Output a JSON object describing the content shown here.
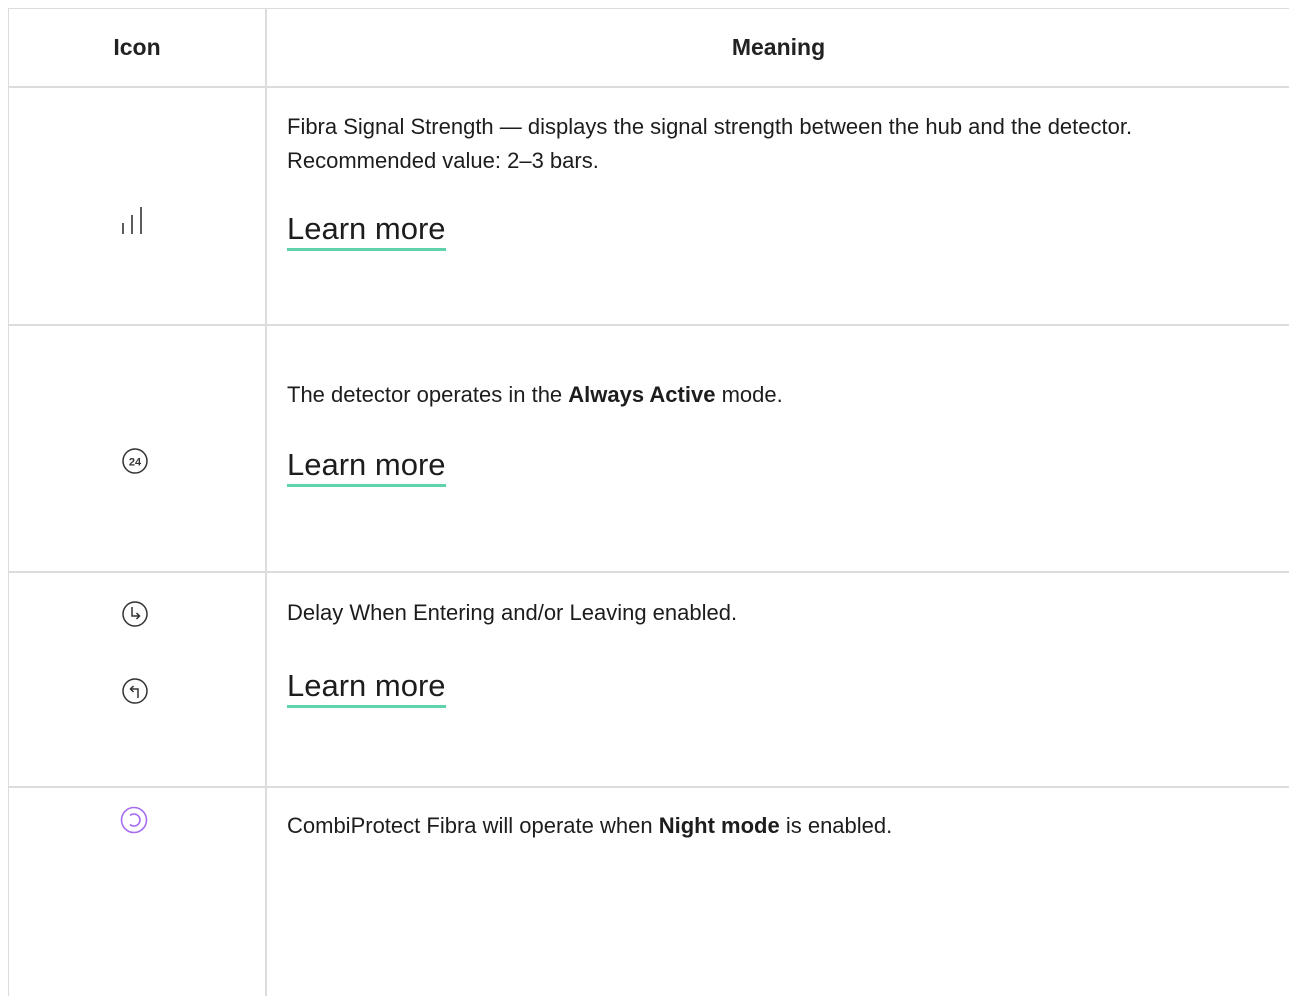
{
  "table": {
    "headers": {
      "icon": "Icon",
      "meaning": "Meaning"
    },
    "rows": [
      {
        "icons": [
          "signal-strength-icon"
        ],
        "description": "Fibra Signal Strength — displays the signal strength between the hub and the detector. Recommended value: 2–3 bars.",
        "link": "Learn more"
      },
      {
        "icons": [
          "always-active-24-icon"
        ],
        "icon_text": "24",
        "description_before": "The detector operates in the ",
        "description_bold": "Always Active",
        "description_after": " mode.",
        "link": "Learn more"
      },
      {
        "icons": [
          "delay-entering-icon",
          "delay-leaving-icon"
        ],
        "description": "Delay When Entering and/or Leaving enabled.",
        "link": "Learn more"
      },
      {
        "icons": [
          "night-mode-icon"
        ],
        "description_before": "CombiProtect Fibra will operate when ",
        "description_bold": "Night mode",
        "description_after": " is enabled."
      }
    ]
  },
  "colors": {
    "border": "#dcdcdc",
    "link_underline": "#5ed3ab",
    "night_mode_icon": "#a66cf0",
    "text": "#1d1d1d"
  }
}
